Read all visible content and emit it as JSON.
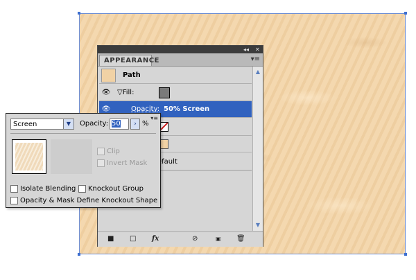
{
  "appearance_panel": {
    "tab_label": "APPEARANCE",
    "collapse_glyph": "◂◂",
    "close_glyph": "✕",
    "menu_glyph": "▾≡",
    "object_type": "Path",
    "object_swatch_color": "#f1d2a5",
    "items": {
      "fill": {
        "label": "Fill:",
        "swatch_color": "#7a7a7a"
      },
      "opacity": {
        "label": "Opacity:",
        "value": "50% Screen",
        "highlight_color": "#3162bf"
      },
      "default_text": "efault"
    },
    "footer_icons": [
      "stroke-square-icon",
      "fill-square-icon",
      "fx-icon",
      "clear-icon",
      "new-item-icon",
      "trash-icon"
    ]
  },
  "transparency_popup": {
    "blend_mode": "Screen",
    "opacity_label": "Opacity:",
    "opacity_value": "50",
    "percent_sign": "%",
    "checkboxes": {
      "clip": "Clip",
      "invert_mask": "Invert Mask",
      "isolate_blending": "Isolate Blending",
      "knockout_group": "Knockout Group",
      "opacity_mask_knockout": "Opacity & Mask Define Knockout Shape"
    }
  },
  "artboard": {
    "fill_color": "#f1d2a5",
    "selection_color": "#3e6fd0"
  }
}
